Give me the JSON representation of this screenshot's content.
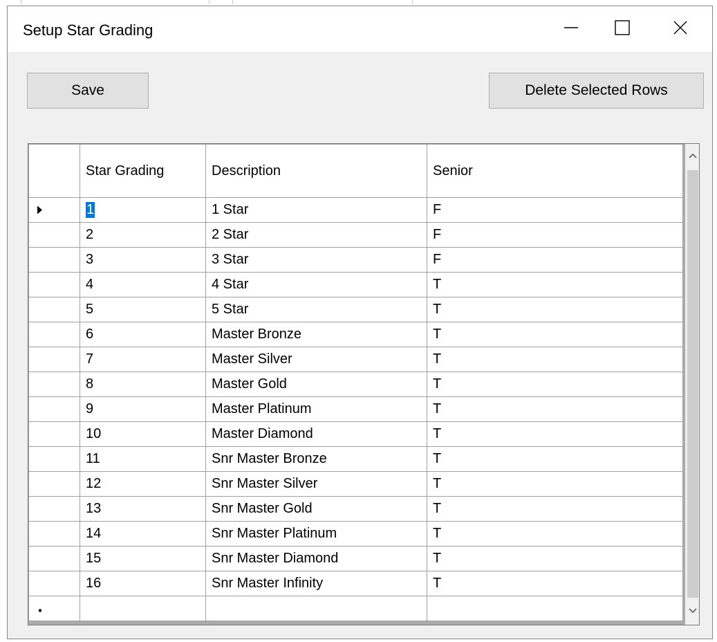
{
  "window": {
    "title": "Setup Star Grading",
    "controls": {
      "minimize_icon": "minimize-icon",
      "maximize_icon": "maximize-icon",
      "close_icon": "close-icon"
    }
  },
  "toolbar": {
    "save_label": "Save",
    "delete_label": "Delete Selected Rows"
  },
  "grid": {
    "columns": [
      "Star Grading",
      "Description",
      "Senior"
    ],
    "rows": [
      {
        "grading": "1",
        "description": "1 Star",
        "senior": "F"
      },
      {
        "grading": "2",
        "description": "2 Star",
        "senior": "F"
      },
      {
        "grading": "3",
        "description": "3 Star",
        "senior": "F"
      },
      {
        "grading": "4",
        "description": "4 Star",
        "senior": "T"
      },
      {
        "grading": "5",
        "description": "5 Star",
        "senior": "T"
      },
      {
        "grading": "6",
        "description": "Master Bronze",
        "senior": "T"
      },
      {
        "grading": "7",
        "description": "Master Silver",
        "senior": "T"
      },
      {
        "grading": "8",
        "description": "Master Gold",
        "senior": "T"
      },
      {
        "grading": "9",
        "description": "Master Platinum",
        "senior": "T"
      },
      {
        "grading": "10",
        "description": "Master Diamond",
        "senior": "T"
      },
      {
        "grading": "11",
        "description": "Snr Master Bronze",
        "senior": "T"
      },
      {
        "grading": "12",
        "description": "Snr Master Silver",
        "senior": "T"
      },
      {
        "grading": "13",
        "description": "Snr Master Gold",
        "senior": "T"
      },
      {
        "grading": "14",
        "description": "Snr Master Platinum",
        "senior": "T"
      },
      {
        "grading": "15",
        "description": "Snr Master Diamond",
        "senior": "T"
      },
      {
        "grading": "16",
        "description": "Snr Master Infinity",
        "senior": "T"
      }
    ],
    "current_row_icon": "current-row-arrow-icon",
    "new_row_icon": "new-row-star-icon",
    "selection_color": "#0078d7"
  }
}
